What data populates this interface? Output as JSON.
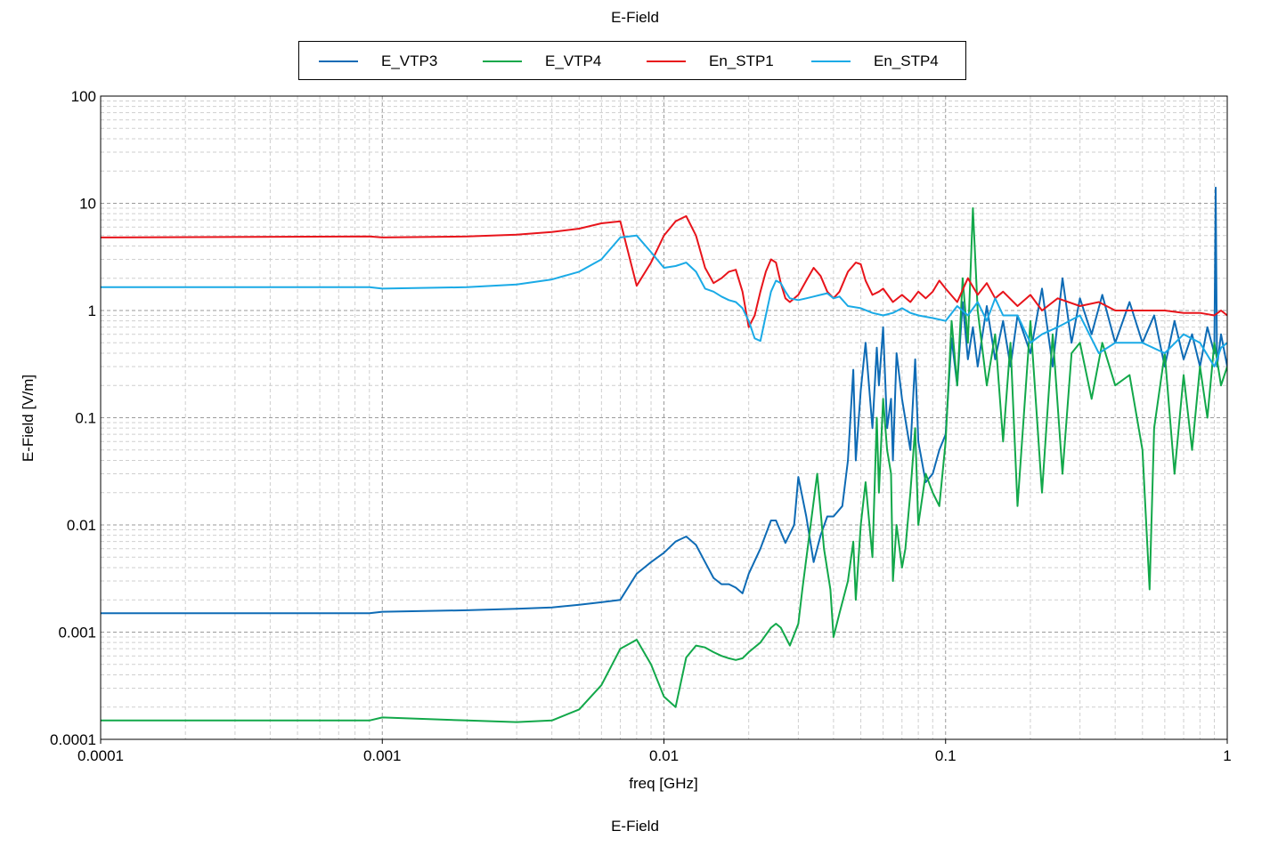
{
  "title": "E-Field",
  "footer_title": "E-Field",
  "colors": {
    "E_VTP3": "#0E6BB5",
    "E_VTP4": "#12A84A",
    "En_STP1": "#E8141B",
    "En_STP4": "#1AAAE6",
    "grid_major": "#9a9a9a",
    "grid_minor": "#cfcfcf"
  },
  "legend": [
    {
      "label": "E_VTP3"
    },
    {
      "label": "E_VTP4"
    },
    {
      "label": "En_STP1"
    },
    {
      "label": "En_STP4"
    }
  ],
  "chart_data": {
    "type": "line",
    "title": "E-Field",
    "xlabel": "freq [GHz]",
    "ylabel": "E-Field [V/m]",
    "x_scale": "log",
    "y_scale": "log",
    "xlim": [
      0.0001,
      1
    ],
    "ylim": [
      0.0001,
      100
    ],
    "grid": true,
    "legend_position": "top",
    "x_ticks": [
      "0.0001",
      "0.001",
      "0.01",
      "0.1",
      "1"
    ],
    "y_ticks": [
      "0.0001",
      "0.001",
      "0.01",
      "0.1",
      "1",
      "10",
      "100"
    ],
    "series": [
      {
        "name": "E_VTP3",
        "x": [
          0.0001,
          0.0009,
          0.001,
          0.002,
          0.003,
          0.004,
          0.005,
          0.006,
          0.007,
          0.008,
          0.009,
          0.01,
          0.011,
          0.012,
          0.013,
          0.014,
          0.015,
          0.016,
          0.017,
          0.018,
          0.019,
          0.02,
          0.022,
          0.024,
          0.025,
          0.027,
          0.029,
          0.03,
          0.032,
          0.034,
          0.036,
          0.038,
          0.04,
          0.043,
          0.045,
          0.047,
          0.048,
          0.05,
          0.052,
          0.055,
          0.057,
          0.058,
          0.06,
          0.062,
          0.064,
          0.065,
          0.067,
          0.07,
          0.075,
          0.078,
          0.08,
          0.085,
          0.09,
          0.095,
          0.1,
          0.105,
          0.11,
          0.115,
          0.12,
          0.125,
          0.13,
          0.14,
          0.15,
          0.16,
          0.17,
          0.18,
          0.2,
          0.22,
          0.24,
          0.26,
          0.28,
          0.3,
          0.33,
          0.36,
          0.4,
          0.45,
          0.5,
          0.55,
          0.6,
          0.65,
          0.7,
          0.75,
          0.8,
          0.85,
          0.9,
          0.91,
          0.92,
          0.95,
          1.0
        ],
        "y": [
          0.0015,
          0.0015,
          0.00155,
          0.0016,
          0.00165,
          0.0017,
          0.0018,
          0.0019,
          0.002,
          0.0035,
          0.0045,
          0.0055,
          0.007,
          0.0078,
          0.0065,
          0.0045,
          0.0032,
          0.0028,
          0.0028,
          0.0026,
          0.0023,
          0.0035,
          0.006,
          0.011,
          0.011,
          0.0068,
          0.01,
          0.028,
          0.012,
          0.0045,
          0.008,
          0.012,
          0.012,
          0.015,
          0.04,
          0.28,
          0.04,
          0.18,
          0.5,
          0.08,
          0.45,
          0.2,
          0.7,
          0.08,
          0.15,
          0.04,
          0.4,
          0.15,
          0.05,
          0.35,
          0.06,
          0.025,
          0.03,
          0.05,
          0.07,
          0.55,
          0.2,
          1.2,
          0.35,
          0.7,
          0.3,
          1.1,
          0.35,
          0.8,
          0.3,
          0.9,
          0.4,
          1.6,
          0.3,
          2.0,
          0.5,
          1.3,
          0.6,
          1.4,
          0.5,
          1.2,
          0.5,
          0.9,
          0.3,
          0.8,
          0.35,
          0.6,
          0.3,
          0.7,
          0.4,
          14.0,
          0.3,
          0.6,
          0.3
        ]
      },
      {
        "name": "E_VTP4",
        "x": [
          0.0001,
          0.0009,
          0.001,
          0.002,
          0.003,
          0.004,
          0.005,
          0.006,
          0.007,
          0.008,
          0.009,
          0.01,
          0.011,
          0.012,
          0.013,
          0.014,
          0.015,
          0.016,
          0.017,
          0.018,
          0.019,
          0.02,
          0.022,
          0.024,
          0.025,
          0.026,
          0.028,
          0.03,
          0.031,
          0.033,
          0.035,
          0.037,
          0.039,
          0.04,
          0.042,
          0.045,
          0.047,
          0.048,
          0.05,
          0.052,
          0.055,
          0.057,
          0.058,
          0.06,
          0.062,
          0.064,
          0.065,
          0.067,
          0.07,
          0.072,
          0.075,
          0.078,
          0.08,
          0.085,
          0.09,
          0.095,
          0.1,
          0.105,
          0.11,
          0.115,
          0.12,
          0.125,
          0.13,
          0.14,
          0.15,
          0.16,
          0.17,
          0.18,
          0.2,
          0.22,
          0.24,
          0.26,
          0.28,
          0.3,
          0.33,
          0.36,
          0.4,
          0.45,
          0.5,
          0.53,
          0.55,
          0.6,
          0.65,
          0.7,
          0.75,
          0.8,
          0.85,
          0.9,
          0.95,
          1.0
        ],
        "y": [
          0.00015,
          0.00015,
          0.00016,
          0.00015,
          0.000145,
          0.00015,
          0.00019,
          0.00032,
          0.0007,
          0.00085,
          0.0005,
          0.00025,
          0.0002,
          0.00058,
          0.00075,
          0.00072,
          0.00065,
          0.0006,
          0.00057,
          0.00055,
          0.00057,
          0.00065,
          0.0008,
          0.0011,
          0.0012,
          0.0011,
          0.00075,
          0.0012,
          0.0025,
          0.009,
          0.03,
          0.006,
          0.0025,
          0.0009,
          0.0015,
          0.003,
          0.007,
          0.002,
          0.01,
          0.025,
          0.005,
          0.1,
          0.02,
          0.15,
          0.05,
          0.03,
          0.003,
          0.01,
          0.004,
          0.006,
          0.02,
          0.08,
          0.01,
          0.03,
          0.02,
          0.015,
          0.06,
          0.8,
          0.2,
          2.0,
          0.5,
          9.0,
          1.0,
          0.2,
          0.6,
          0.06,
          0.5,
          0.015,
          0.8,
          0.02,
          0.6,
          0.03,
          0.4,
          0.5,
          0.15,
          0.5,
          0.2,
          0.25,
          0.05,
          0.0025,
          0.08,
          0.4,
          0.03,
          0.25,
          0.05,
          0.3,
          0.1,
          0.5,
          0.2,
          0.3
        ]
      },
      {
        "name": "En_STP1",
        "x": [
          0.0001,
          0.0009,
          0.001,
          0.002,
          0.003,
          0.004,
          0.005,
          0.006,
          0.007,
          0.008,
          0.009,
          0.01,
          0.011,
          0.012,
          0.013,
          0.014,
          0.015,
          0.016,
          0.017,
          0.018,
          0.019,
          0.02,
          0.021,
          0.022,
          0.023,
          0.024,
          0.025,
          0.026,
          0.027,
          0.028,
          0.03,
          0.032,
          0.034,
          0.036,
          0.038,
          0.04,
          0.042,
          0.045,
          0.048,
          0.05,
          0.052,
          0.055,
          0.058,
          0.06,
          0.065,
          0.07,
          0.075,
          0.08,
          0.085,
          0.09,
          0.095,
          0.1,
          0.11,
          0.12,
          0.13,
          0.14,
          0.15,
          0.16,
          0.18,
          0.2,
          0.22,
          0.25,
          0.3,
          0.35,
          0.4,
          0.5,
          0.6,
          0.7,
          0.8,
          0.9,
          0.95,
          1.0
        ],
        "y": [
          4.8,
          4.9,
          4.8,
          4.9,
          5.1,
          5.4,
          5.8,
          6.5,
          6.8,
          1.7,
          2.8,
          5.0,
          6.8,
          7.6,
          5.0,
          2.5,
          1.8,
          2.0,
          2.3,
          2.4,
          1.5,
          0.7,
          0.9,
          1.5,
          2.3,
          3.0,
          2.8,
          1.8,
          1.3,
          1.2,
          1.4,
          1.9,
          2.5,
          2.1,
          1.5,
          1.3,
          1.5,
          2.3,
          2.8,
          2.7,
          1.9,
          1.4,
          1.5,
          1.6,
          1.2,
          1.4,
          1.2,
          1.5,
          1.3,
          1.5,
          1.9,
          1.6,
          1.2,
          2.0,
          1.4,
          1.8,
          1.3,
          1.5,
          1.1,
          1.4,
          1.0,
          1.3,
          1.1,
          1.2,
          1.0,
          1.0,
          1.0,
          0.95,
          0.95,
          0.9,
          1.0,
          0.9
        ]
      },
      {
        "name": "En_STP4",
        "x": [
          0.0001,
          0.0009,
          0.001,
          0.002,
          0.003,
          0.004,
          0.005,
          0.006,
          0.007,
          0.008,
          0.009,
          0.01,
          0.011,
          0.012,
          0.013,
          0.014,
          0.015,
          0.016,
          0.017,
          0.018,
          0.019,
          0.02,
          0.021,
          0.022,
          0.023,
          0.024,
          0.025,
          0.026,
          0.027,
          0.028,
          0.03,
          0.032,
          0.034,
          0.036,
          0.038,
          0.04,
          0.042,
          0.045,
          0.05,
          0.055,
          0.06,
          0.065,
          0.07,
          0.075,
          0.08,
          0.09,
          0.1,
          0.11,
          0.12,
          0.13,
          0.14,
          0.15,
          0.16,
          0.18,
          0.2,
          0.22,
          0.25,
          0.3,
          0.35,
          0.4,
          0.5,
          0.6,
          0.7,
          0.8,
          0.9,
          0.95,
          1.0
        ],
        "y": [
          1.65,
          1.65,
          1.6,
          1.65,
          1.75,
          1.95,
          2.3,
          3.0,
          4.8,
          5.0,
          3.5,
          2.5,
          2.6,
          2.8,
          2.3,
          1.6,
          1.5,
          1.35,
          1.25,
          1.2,
          1.05,
          0.8,
          0.55,
          0.52,
          0.9,
          1.5,
          1.9,
          1.8,
          1.5,
          1.3,
          1.25,
          1.3,
          1.35,
          1.4,
          1.45,
          1.3,
          1.35,
          1.1,
          1.05,
          0.95,
          0.9,
          0.95,
          1.05,
          0.95,
          0.9,
          0.85,
          0.8,
          1.1,
          0.9,
          1.2,
          0.8,
          1.3,
          0.9,
          0.9,
          0.5,
          0.6,
          0.7,
          0.9,
          0.4,
          0.5,
          0.5,
          0.4,
          0.6,
          0.5,
          0.3,
          0.45,
          0.5
        ]
      }
    ]
  }
}
